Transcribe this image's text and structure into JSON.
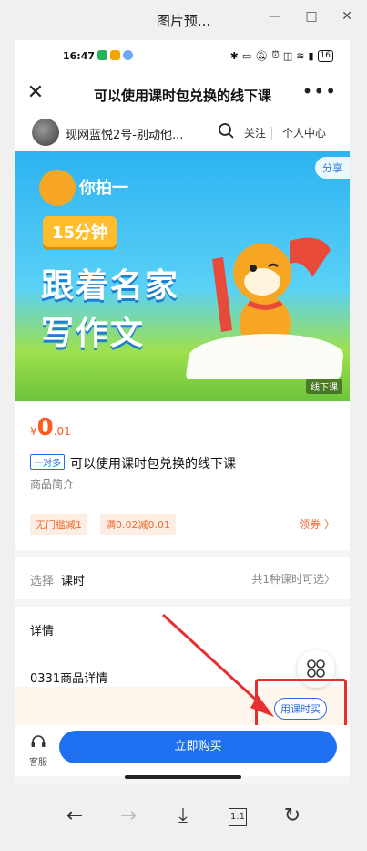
{
  "window": {
    "title": "图片预...",
    "buttons": {
      "minimize": "—",
      "maximize": "□",
      "close": "✕"
    }
  },
  "status_bar": {
    "time": "16:47",
    "battery": "16",
    "colors": {
      "app1": "#22b35b",
      "app2": "#f2a400",
      "app3": "#6fa8f5"
    }
  },
  "nav": {
    "title": "可以使用课时包兑换的线下课",
    "close": "✕",
    "more": "•••"
  },
  "shop": {
    "name": "现网蓝悦2号-别动他...",
    "follow": "关注",
    "center": "个人中心"
  },
  "banner": {
    "logo_text": "你拍一",
    "pill": "15分钟",
    "line1": "跟着名家",
    "line2": "写作文",
    "share": "分享",
    "offline_tag": "线下课"
  },
  "product": {
    "currency": "¥",
    "price_int": "0",
    "price_dec": ".01",
    "tag": "一对多",
    "title": "可以使用课时包兑换的线下课",
    "intro": "商品简介",
    "coupons": [
      "无门槛减1",
      "满0.02减0.01"
    ],
    "claim": "领券 〉"
  },
  "choose": {
    "label": "选择",
    "value": "课时",
    "right": "共1种课时可选〉"
  },
  "detail": {
    "heading": "详情",
    "body": "0331商品详情",
    "hour_button": "用课时买"
  },
  "bottom": {
    "service": "客服",
    "buy": "立即购买"
  },
  "colors": {
    "accent": "#1f6ff1",
    "price": "#ff5a1f",
    "coupon": "#ee6b33",
    "highlight": "#e53030"
  }
}
